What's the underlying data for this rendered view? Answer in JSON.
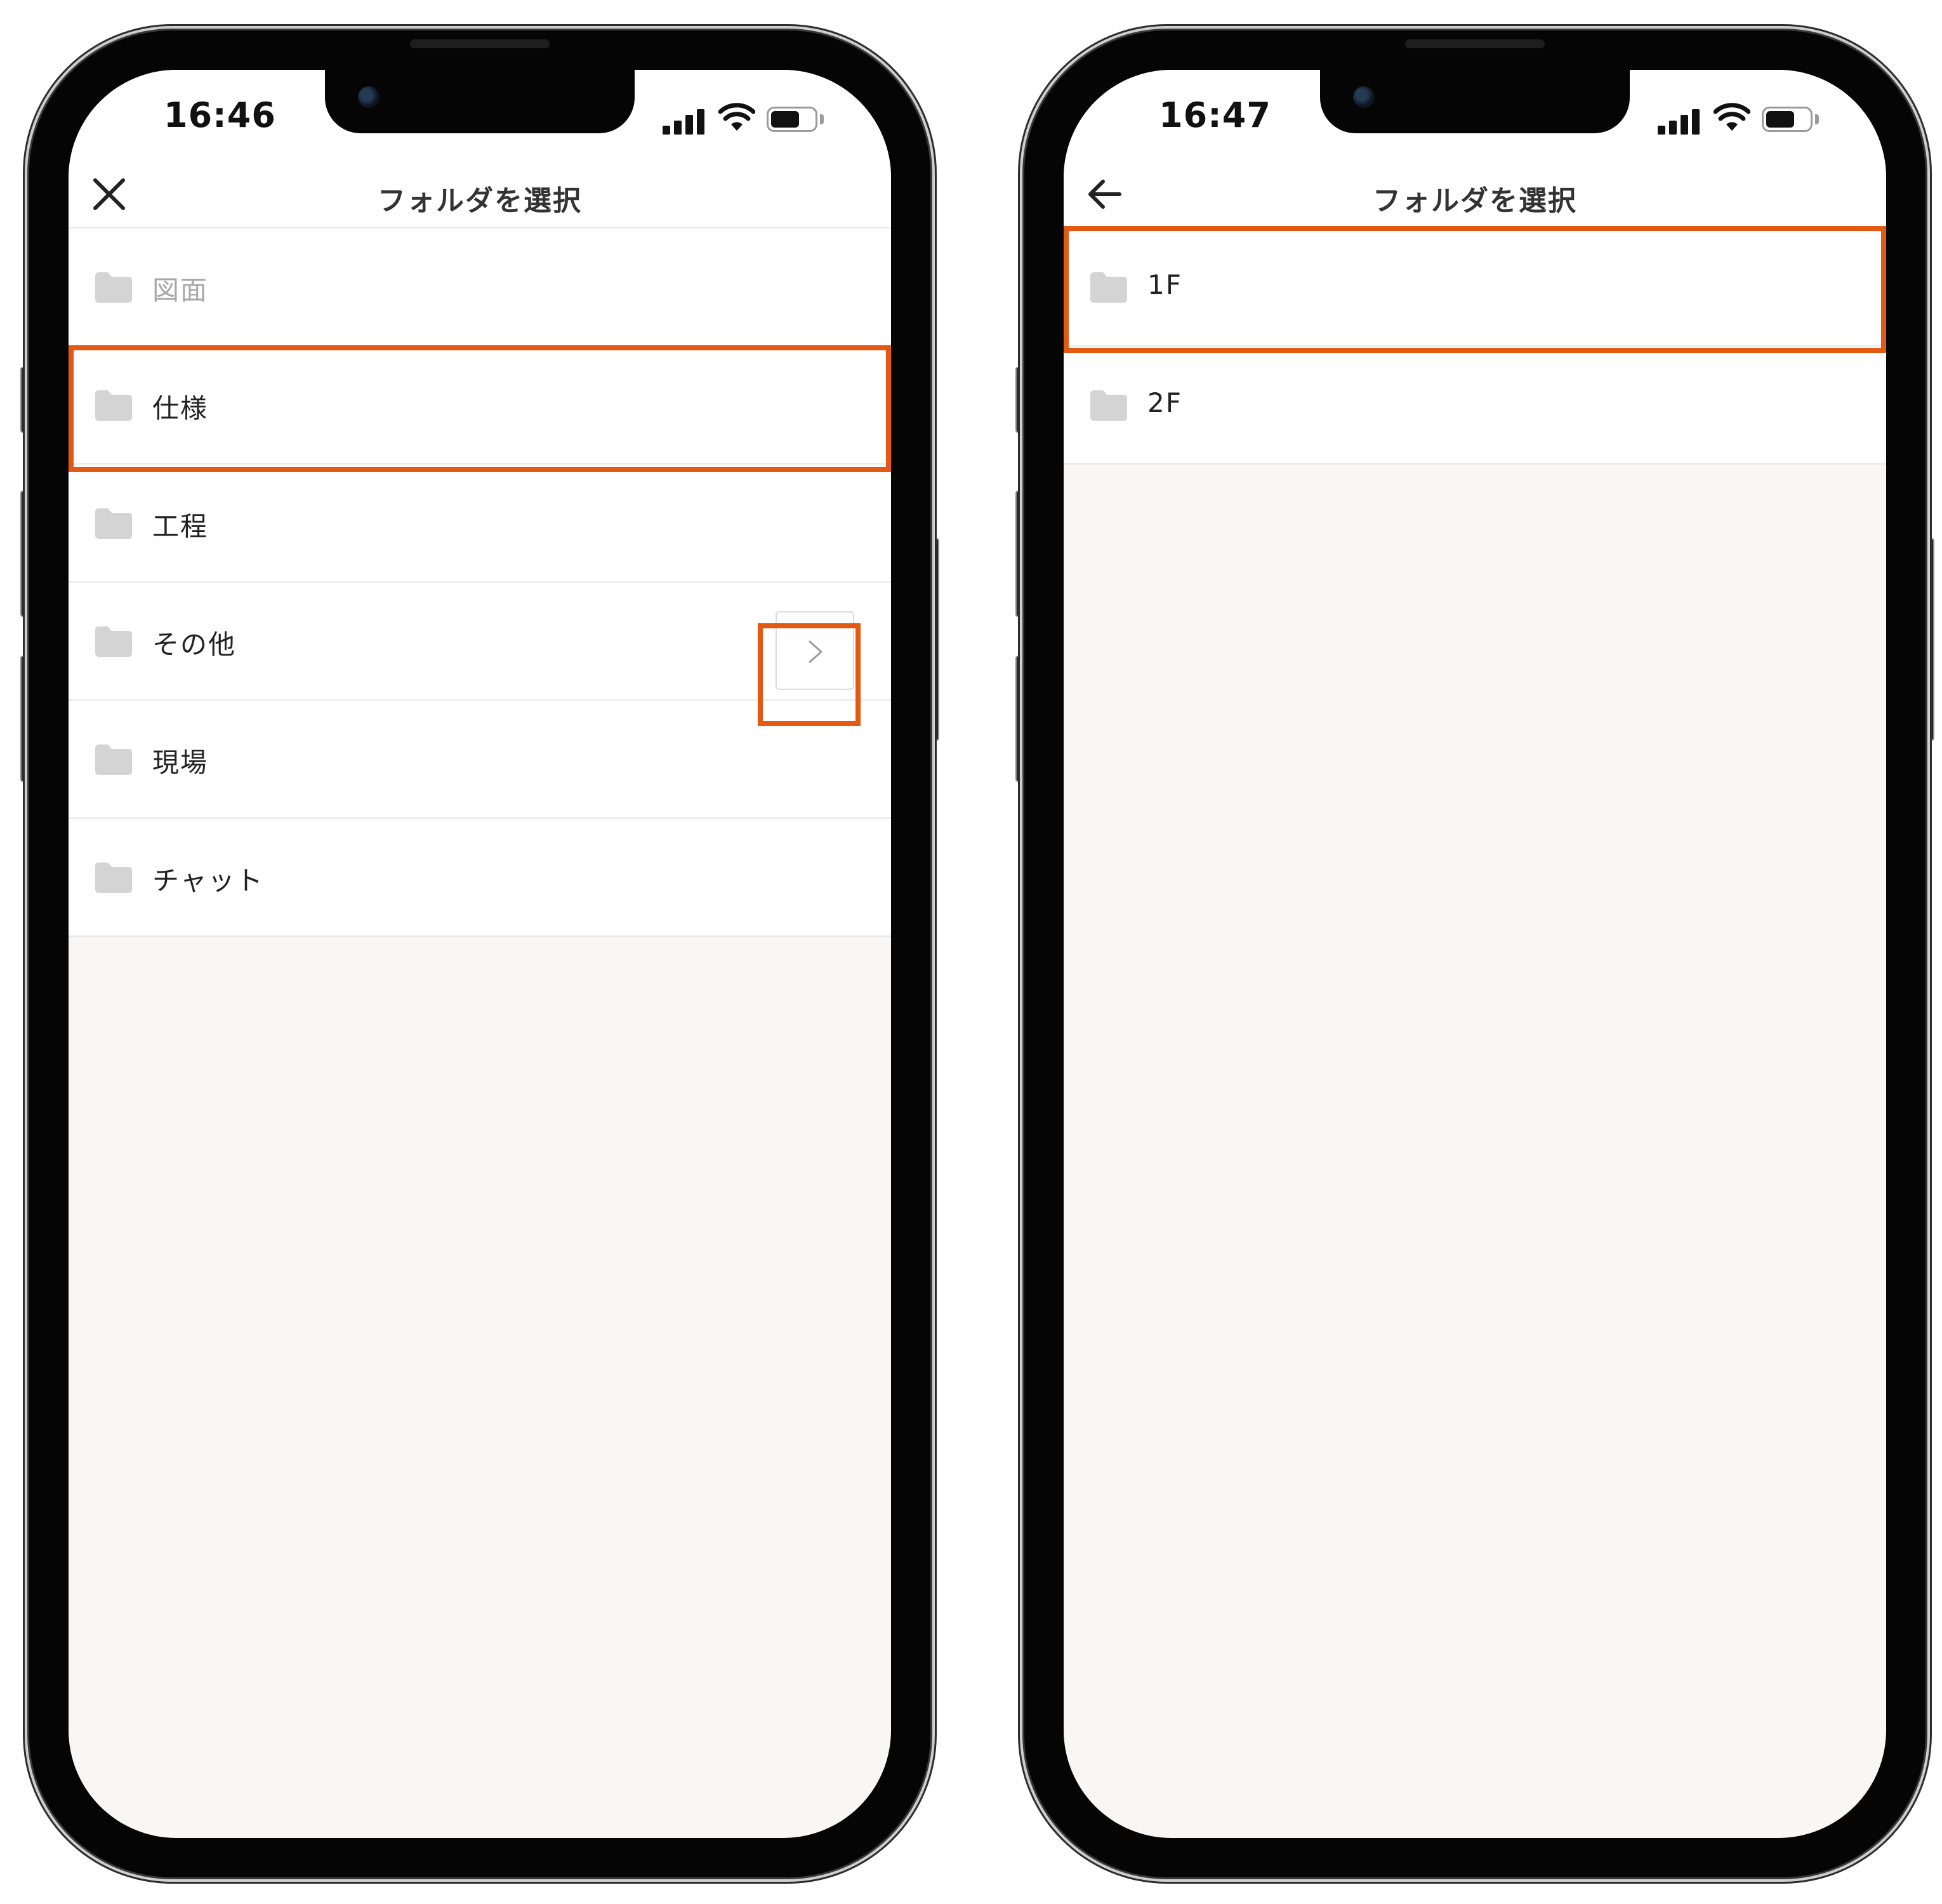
{
  "screens": [
    {
      "time": "16:46",
      "nav_icon": "close-icon",
      "title": "フォルダを選択",
      "folders": [
        {
          "label": "図面",
          "disabled": true
        },
        {
          "label": "仕様"
        },
        {
          "label": "工程"
        },
        {
          "label": "その他",
          "has_subfolders": true
        },
        {
          "label": "現場"
        },
        {
          "label": "チャット"
        }
      ]
    },
    {
      "time": "16:47",
      "nav_icon": "back-arrow-icon",
      "title": "フォルダを選択",
      "folders": [
        {
          "label": "1F"
        },
        {
          "label": "2F"
        }
      ]
    }
  ],
  "colors": {
    "highlight": "#e55a12",
    "folder_icon": "#d4d4d4",
    "background": "#f8f7f5",
    "disabled_text": "#a8a8a8"
  }
}
